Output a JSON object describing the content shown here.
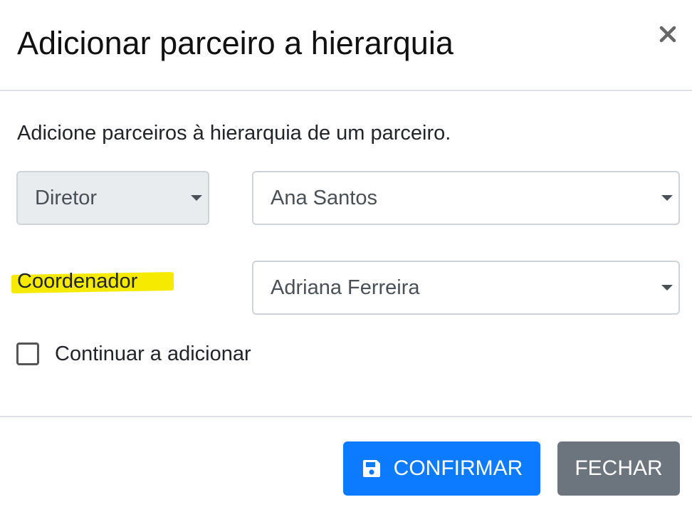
{
  "modal": {
    "title": "Adicionar parceiro a hierarquia",
    "close_icon": "close-icon",
    "description": "Adicione parceiros à hierarquia de um parceiro.",
    "row1": {
      "role_value": "Diretor",
      "role_disabled": true,
      "person_value": "Ana Santos"
    },
    "row2": {
      "role_label": "Coordenador",
      "highlight_color": "#f5ea00",
      "person_value": "Adriana Ferreira"
    },
    "continue_checkbox": {
      "label": "Continuar a adicionar",
      "checked": false
    },
    "footer": {
      "confirm_label": "CONFIRMAR",
      "confirm_icon": "save-icon",
      "confirm_color": "#0d7bff",
      "close_label": "FECHAR",
      "close_color": "#6c757d"
    }
  }
}
